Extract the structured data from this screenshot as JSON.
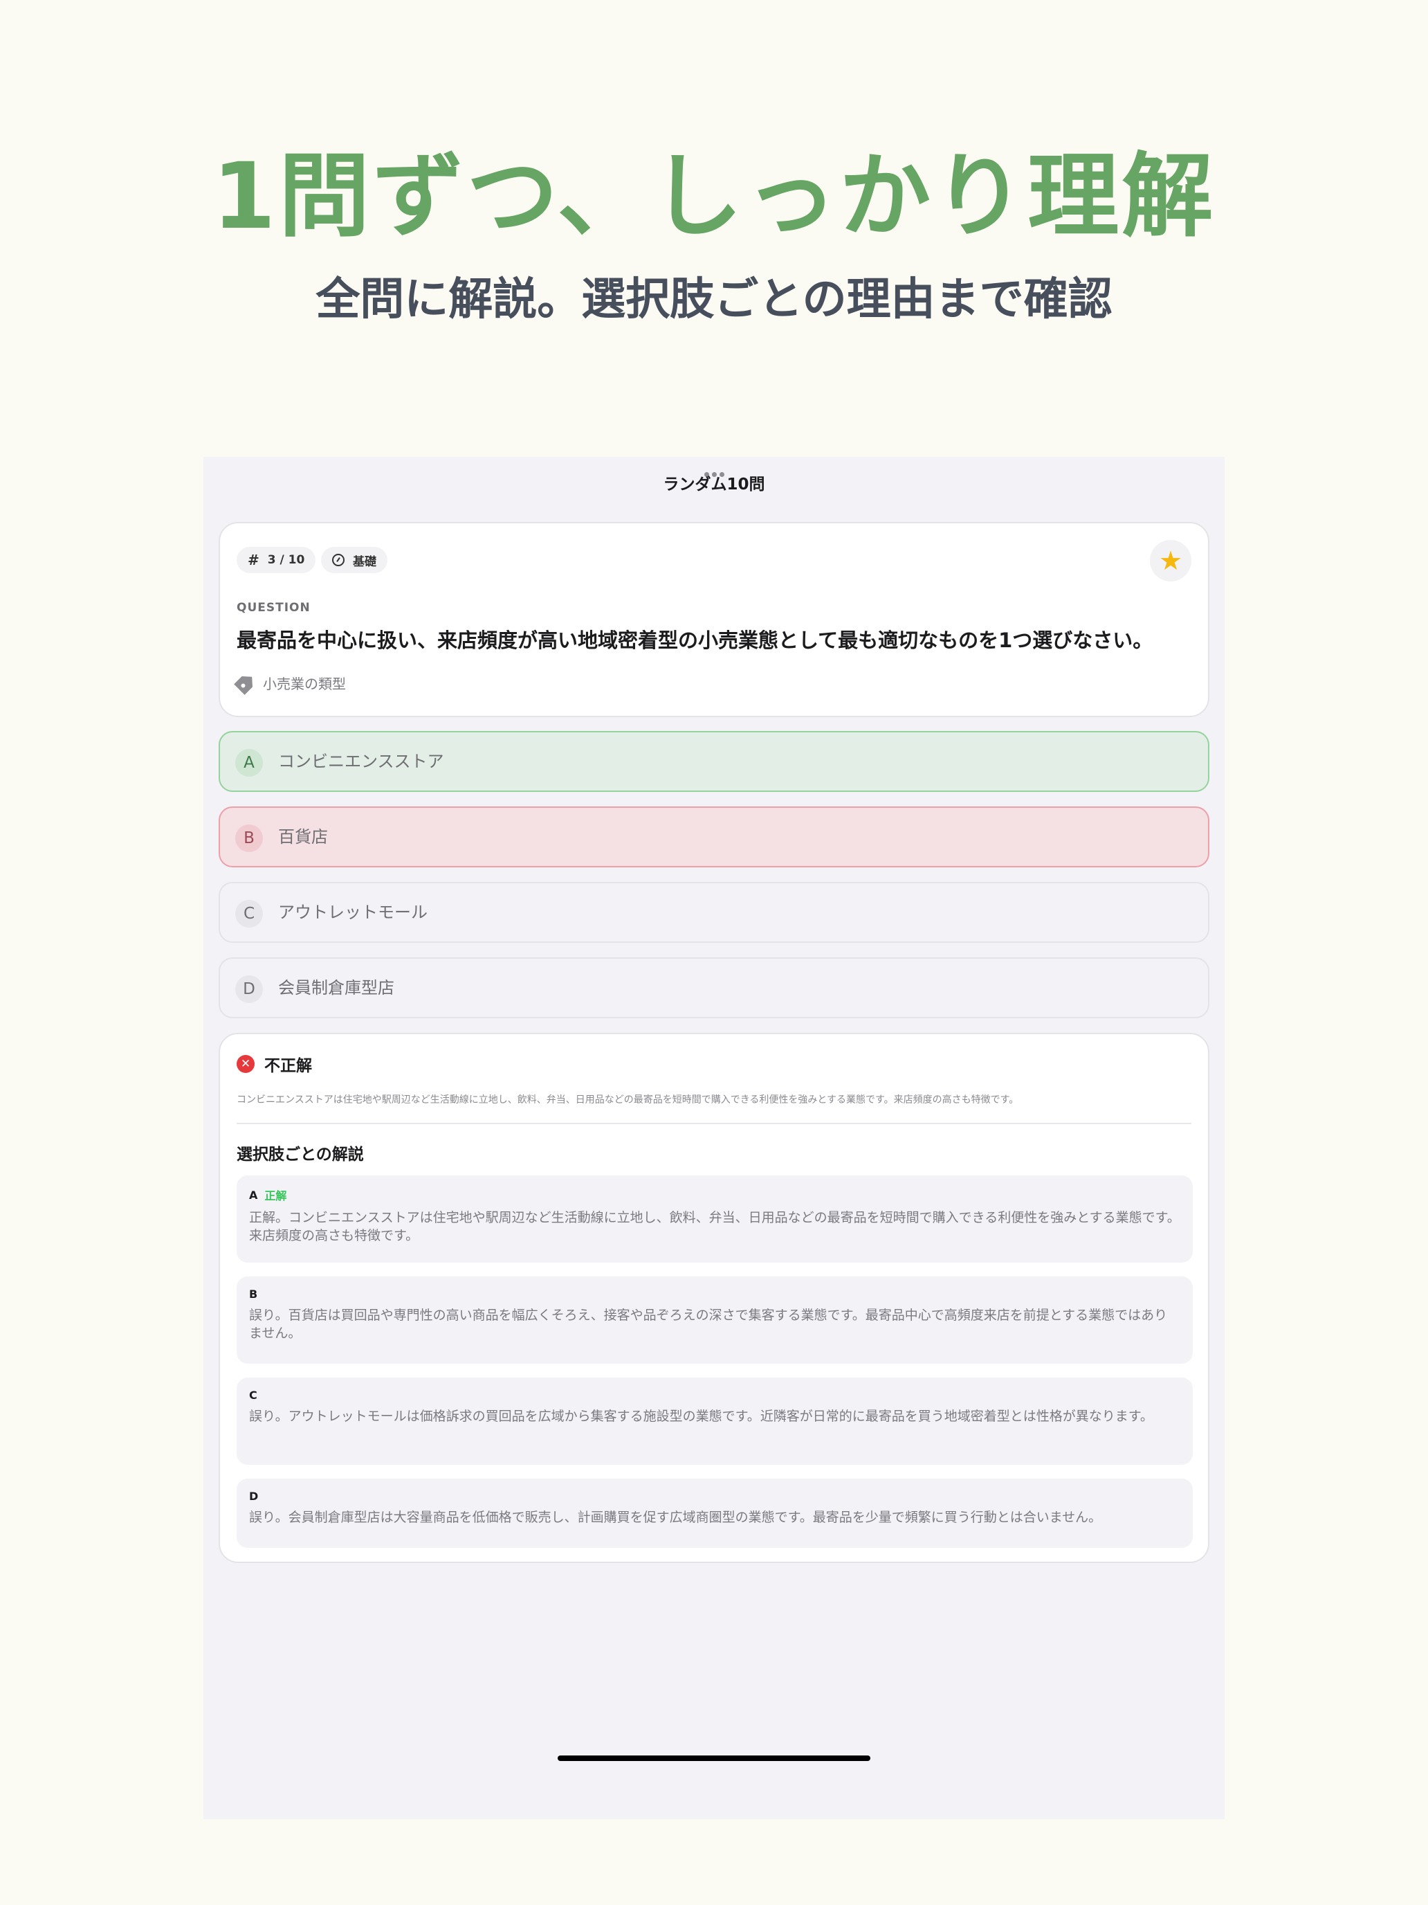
{
  "hero": {
    "title": "1問ずつ、しっかり理解",
    "subtitle": "全問に解説。選択肢ごとの理由まで確認"
  },
  "nav": {
    "title": "ランダム10問"
  },
  "question": {
    "number": "3 / 10",
    "number_icon": "hash-icon",
    "level": "基礎",
    "level_icon": "gauge-icon",
    "favorite_icon": "star-icon",
    "favorite_color": "#F5B80F",
    "label": "QUESTION",
    "text": "最寄品を中心に扱い、来店頻度が高い地域密着型の小売業態として最も適切なものを1つ選びなさい。",
    "tag_icon": "tag-icon",
    "tag": "小売業の類型"
  },
  "options": [
    {
      "letter": "A",
      "text": "コンビニエンスストア",
      "state": "correct"
    },
    {
      "letter": "B",
      "text": "百貨店",
      "state": "wrong"
    },
    {
      "letter": "C",
      "text": "アウトレットモール",
      "state": "neutral"
    },
    {
      "letter": "D",
      "text": "会員制倉庫型店",
      "state": "neutral"
    }
  ],
  "explanation": {
    "result_icon": "x-circle-icon",
    "result": "不正解",
    "summary": "コンビニエンスストアは住宅地や駅周辺など生活動線に立地し、飲料、弁当、日用品などの最寄品を短時間で購入できる利便性を強みとする業態です。来店頻度の高さも特徴です。",
    "heading": "選択肢ごとの解説",
    "choices": [
      {
        "letter": "A",
        "badge": "正解",
        "text": "正解。コンビニエンスストアは住宅地や駅周辺など生活動線に立地し、飲料、弁当、日用品などの最寄品を短時間で購入できる利便性を強みとする業態です。来店頻度の高さも特徴です。"
      },
      {
        "letter": "B",
        "badge": "",
        "text": "誤り。百貨店は買回品や専門性の高い商品を幅広くそろえ、接客や品ぞろえの深さで集客する業態です。最寄品中心で高頻度来店を前提とする業態ではありません。"
      },
      {
        "letter": "C",
        "badge": "",
        "text": "誤り。アウトレットモールは価格訴求の買回品を広域から集客する施設型の業態です。近隣客が日常的に最寄品を買う地域密着型とは性格が異なります。"
      },
      {
        "letter": "D",
        "badge": "",
        "text": "誤り。会員制倉庫型店は大容量商品を低価格で販売し、計画購買を促す広域商圏型の業態です。最寄品を少量で頻繁に買う行動とは合いません。"
      }
    ]
  },
  "colors": {
    "hero_title": "#66A563",
    "correct": "#34C759",
    "wrong": "#E5393B"
  }
}
